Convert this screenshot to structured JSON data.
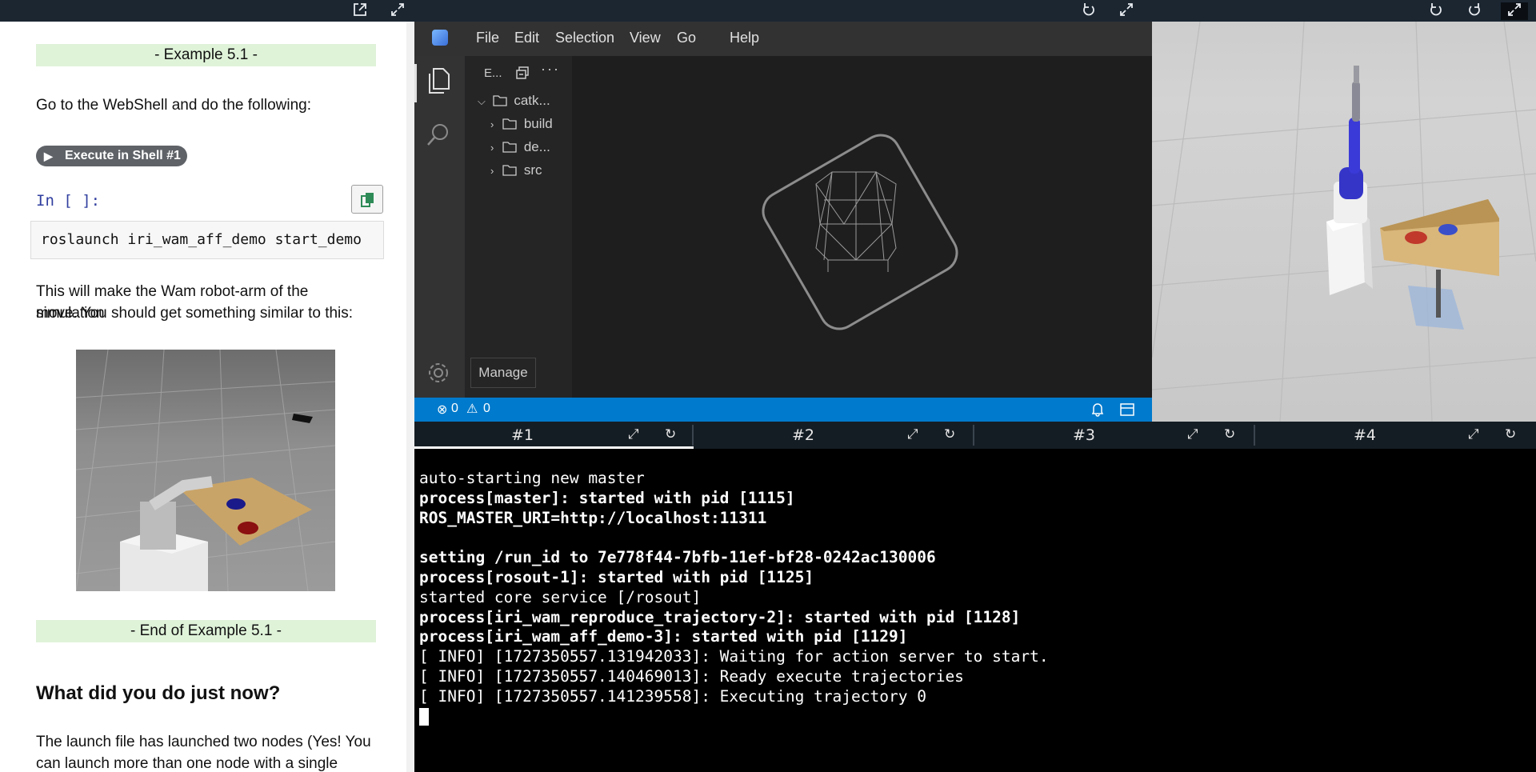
{
  "notebook": {
    "example_start": "- Example 5.1 -",
    "intro": "Go to the WebShell and do the following:",
    "exec_button": "Execute in Shell #1",
    "in_prompt": "In [ ]:",
    "code": "roslaunch iri_wam_aff_demo start_demo",
    "desc_line1": "This will make the Wam robot-arm of the simulation",
    "desc_line2": "move. You should get something similar to this:",
    "example_end": "- End of Example 5.1 -",
    "heading": "What did you do just now?",
    "para_line1": "The launch file has launched two nodes (Yes! You",
    "para_line2": "can launch more than one node with a single"
  },
  "vscode": {
    "menu": [
      "File",
      "Edit",
      "Selection",
      "View",
      "Go",
      "Help"
    ],
    "explorer_title": "E...",
    "tree": {
      "root": "catk...",
      "children": [
        "build",
        "de...",
        "src"
      ]
    },
    "manage_tooltip": "Manage",
    "status": {
      "errors": "0",
      "warnings": "0"
    }
  },
  "tabs": [
    {
      "label": "#1",
      "active": true
    },
    {
      "label": "#2",
      "active": false
    },
    {
      "label": "#3",
      "active": false
    },
    {
      "label": "#4",
      "active": false
    }
  ],
  "terminal": {
    "lines": [
      {
        "text": "auto-starting new master",
        "bold": false
      },
      {
        "text": "process[master]: started with pid [1115]",
        "bold": true
      },
      {
        "text": "ROS_MASTER_URI=http://localhost:11311",
        "bold": true
      },
      {
        "text": "",
        "bold": false
      },
      {
        "text": "setting /run_id to 7e778f44-7bfb-11ef-bf28-0242ac130006",
        "bold": true
      },
      {
        "text": "process[rosout-1]: started with pid [1125]",
        "bold": true
      },
      {
        "text": "started core service [/rosout]",
        "bold": false
      },
      {
        "text": "process[iri_wam_reproduce_trajectory-2]: started with pid [1128]",
        "bold": true
      },
      {
        "text": "process[iri_wam_aff_demo-3]: started with pid [1129]",
        "bold": true
      },
      {
        "text": "[ INFO] [1727350557.131942033]: Waiting for action server to start.",
        "bold": false
      },
      {
        "text": "[ INFO] [1727350557.140469013]: Ready execute trajectories",
        "bold": false
      },
      {
        "text": "[ INFO] [1727350557.141239558]: Executing trajectory 0",
        "bold": false
      }
    ]
  },
  "colors": {
    "banner_bg": "#dff3d9",
    "status_bar": "#007acc",
    "prompt_blue": "#303f9f"
  }
}
